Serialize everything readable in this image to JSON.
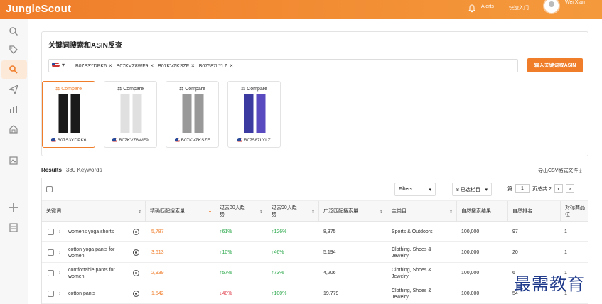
{
  "header": {
    "logo": "JungleScout",
    "alerts": "Alerts",
    "quick_entry": "快速入门",
    "user": "Wei Xian"
  },
  "sidebar": {
    "icons": [
      "search-icon",
      "tag-icon",
      "keyword-search-icon",
      "paper-plane-icon",
      "bar-chart-icon",
      "store-icon",
      "image-icon",
      "puzzle-icon",
      "clipboard-icon"
    ]
  },
  "search": {
    "title": "关键词搜索和ASIN反查",
    "marketplace": "US",
    "asins": [
      "B07S3YDPK6",
      "B07KVZ8WF9",
      "B07KVZKSZF",
      "B07587LYLZ"
    ],
    "submit_label": "输入关键词或ASIN"
  },
  "products": [
    {
      "compare": "Compare",
      "asin": "B07S3YDPK6",
      "selected": true,
      "color": "#1a1a1a"
    },
    {
      "compare": "Compare",
      "asin": "B07KVZ8WF9",
      "selected": false,
      "color": "#e8e8e8"
    },
    {
      "compare": "Compare",
      "asin": "B07KVZKSZF",
      "selected": false,
      "color": "#9a9a9a"
    },
    {
      "compare": "Compare",
      "asin": "B07587LYLZ",
      "selected": false,
      "color": "#3a3aa0"
    }
  ],
  "results": {
    "label": "Results",
    "count": "380 Keywords",
    "export": "导出CSV格式文件"
  },
  "toolbar": {
    "filters": "Filters",
    "columns": "8 已选栏目",
    "page_label": "第",
    "page": "1",
    "total": "页总共 2"
  },
  "columns": [
    "关键词",
    "精确匹配搜索量",
    "过去30天趋势",
    "过去90天趋势",
    "广泛匹配搜索量",
    "主类目",
    "自然搜索结果",
    "自然排名",
    "对标商品位"
  ],
  "rows": [
    {
      "keyword": "womens yoga shorts",
      "exact": "5,787",
      "t30": "↑61%",
      "t30c": "green",
      "t90": "↑126%",
      "t90c": "green",
      "broad": "8,375",
      "cat": "Sports & Outdoors",
      "organic": "100,000",
      "rank": "97",
      "pos": "1"
    },
    {
      "keyword": "cotton yoga pants for women",
      "exact": "3,613",
      "t30": "↑10%",
      "t30c": "green",
      "t90": "↑46%",
      "t90c": "green",
      "broad": "5,194",
      "cat": "Clothing, Shoes & Jewelry",
      "organic": "100,000",
      "rank": "20",
      "pos": "1"
    },
    {
      "keyword": "comfortable pants for women",
      "exact": "2,939",
      "t30": "↑57%",
      "t30c": "green",
      "t90": "↑73%",
      "t90c": "green",
      "broad": "4,206",
      "cat": "Clothing, Shoes & Jewelry",
      "organic": "100,000",
      "rank": "6",
      "pos": "1"
    },
    {
      "keyword": "cotton pants",
      "exact": "1,542",
      "t30": "↓48%",
      "t30c": "red",
      "t90": "↑100%",
      "t90c": "green",
      "broad": "19,779",
      "cat": "Clothing, Shoes & Jewelry",
      "organic": "100,000",
      "rank": "54",
      "pos": "1"
    }
  ],
  "watermark": "最需教育"
}
